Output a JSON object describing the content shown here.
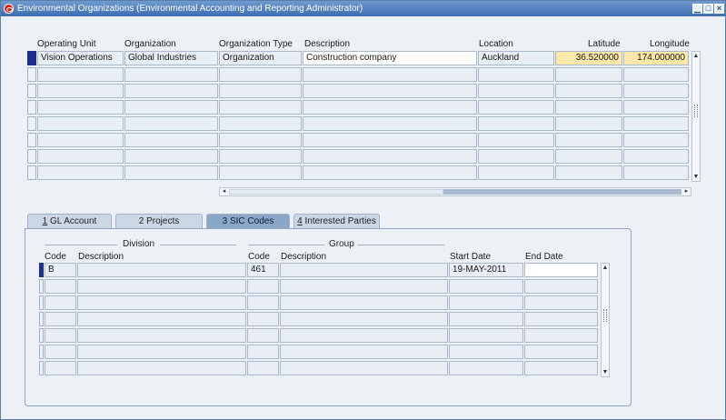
{
  "window": {
    "title": "Environmental Organizations (Environmental Accounting and Reporting Administrator)"
  },
  "org_table": {
    "headers": {
      "operating_unit": "Operating Unit",
      "organization": "Organization",
      "organization_type": "Organization Type",
      "description": "Description",
      "location": "Location",
      "latitude": "Latitude",
      "longitude": "Longitude"
    },
    "rows": [
      {
        "operating_unit": "Vision Operations",
        "organization": "Global Industries",
        "organization_type": "Organization",
        "description": "Construction company",
        "location": "Auckland",
        "latitude": "36.520000",
        "longitude": "174.000000"
      }
    ]
  },
  "tabs": [
    {
      "num": "1",
      "label": " GL Account"
    },
    {
      "num": "2",
      "label": " Projects"
    },
    {
      "num": "3",
      "label": " SIC Codes"
    },
    {
      "num": "4",
      "label": " Interested Parties"
    }
  ],
  "sic_table": {
    "division_group": "Division",
    "group_group": "Group",
    "headers": {
      "code": "Code",
      "description": "Description",
      "group_code": "Code",
      "group_description": "Description",
      "start_date": "Start Date",
      "end_date": "End Date"
    },
    "rows": [
      {
        "code": "B",
        "description": "",
        "group_code": "461",
        "group_description": "",
        "start_date": "19-MAY-2011",
        "end_date": ""
      }
    ]
  }
}
